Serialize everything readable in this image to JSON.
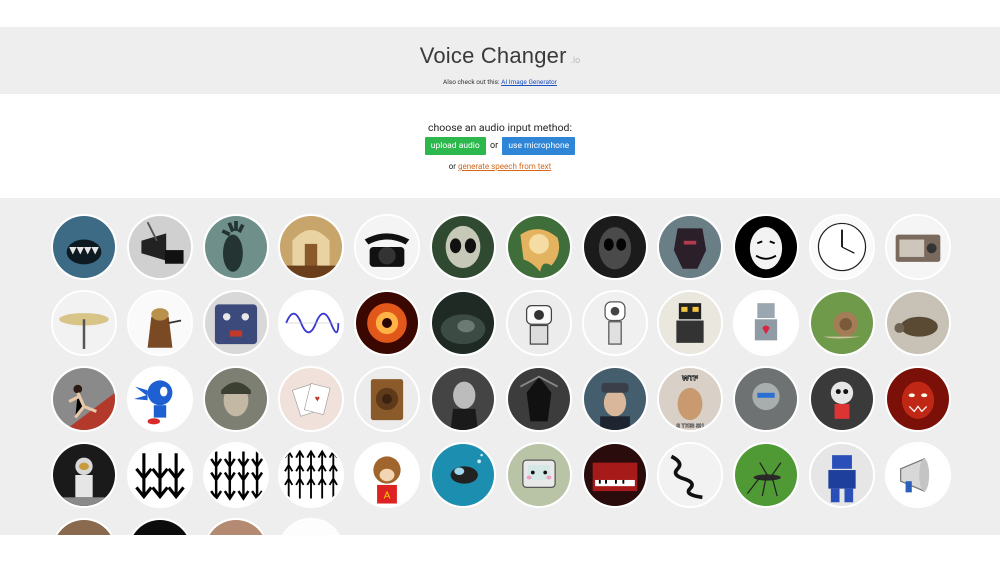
{
  "header": {
    "title": "Voice Changer",
    "title_suffix": ".io",
    "also_prefix": "Also check out this: ",
    "also_link": "AI Image Generator"
  },
  "input": {
    "prompt": "choose an audio input method:",
    "upload_label": "upload audio",
    "or_label": "or",
    "mic_label": "use microphone",
    "gen_prefix": "or ",
    "gen_link": "generate speech from text"
  },
  "colors": {
    "upload_button": "#2db84d",
    "mic_button": "#2f86d6",
    "link_orange": "#d2691e",
    "link_blue": "#1a4fbf"
  },
  "voice_rows": [
    [
      "monster-mouth",
      "megaphone-bw",
      "ghost-hand",
      "church-interior",
      "rotary-telephone",
      "alien-grey",
      "melting-clock",
      "dark-alien",
      "armored-robot-head",
      "guy-fawkes-mask",
      "clock-reversed",
      "portable-radio"
    ],
    [
      "cymbal",
      "dalek",
      "effects-pedal",
      "sine-wave",
      "fire-swirl",
      "dark-cave",
      "white-robot",
      "white-robot-2",
      "retro-toy-robot",
      "toy-robot-heart",
      "snail",
      "tortoise"
    ],
    [
      "sprinter",
      "blue-hedgehog",
      "soldier-portrait",
      "playing-cards",
      "wooden-speaker",
      "vintage-portrait",
      "dark-knight",
      "officer-portrait",
      "wtf-meme",
      "grey-robot-head",
      "small-robot",
      "red-demon"
    ],
    [
      "astronaut",
      "arrows-down-3",
      "arrows-down-4",
      "arrows-up-5",
      "chipmunk",
      "scuba-diver",
      "pink-robot-tv",
      "red-piano",
      "coiled-cable",
      "mosquito",
      "blue-mech-robot",
      "megaphone"
    ],
    [
      "partial-1",
      "partial-2",
      "partial-3",
      "partial-4"
    ]
  ]
}
